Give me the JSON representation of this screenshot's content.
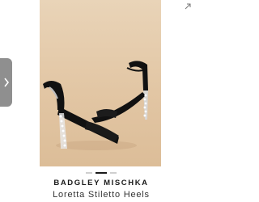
{
  "product": {
    "brand": "BADGLEY MISCHKA",
    "name": "Loretta Stiletto Heels"
  },
  "carousel": {
    "slide_count": 3,
    "active_slide": 2,
    "prev_icon": "chevron-right-icon",
    "expand_icon": "expand-arrow-icon"
  },
  "colors": {
    "image_background": "#e2c6a4",
    "shoe": "#111111",
    "prev_tab": "#8f8f8f",
    "dot_active": "#1a1a1a",
    "dot_inactive": "#cfcfcf"
  }
}
